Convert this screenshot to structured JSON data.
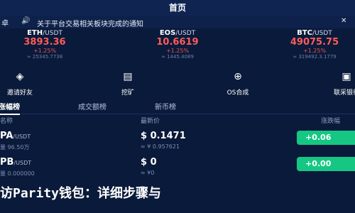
{
  "header": {
    "title": "首页"
  },
  "notice": {
    "mark": "卓",
    "text": "关于平台交易相关板块完成的通知"
  },
  "tickers": [
    {
      "pair_base": "ETH",
      "pair_quote": "/USDT",
      "price": "3893.36",
      "change": "+1.25%",
      "volume": "≈ 25345.7738"
    },
    {
      "pair_base": "EOS",
      "pair_quote": "/USDT",
      "price": "10.6619",
      "change": "+1.25%",
      "volume": "≈ 1445.4089"
    },
    {
      "pair_base": "BTC",
      "pair_quote": "/USDT",
      "price": "49075.75",
      "change": "+1.25%",
      "volume": "≈ 319492.3.1779"
    }
  ],
  "quick": [
    {
      "icon": "gift-icon",
      "label": "邀请好友"
    },
    {
      "icon": "pickaxe-icon",
      "label": "挖矿"
    },
    {
      "icon": "os-icon",
      "label": "OS合成"
    },
    {
      "icon": "bank-icon",
      "label": "联采银行"
    }
  ],
  "tabs": [
    "涨幅榜",
    "成交额榜",
    "新币榜"
  ],
  "columns": {
    "name": "名称",
    "price": "最新价",
    "change": "涨跌幅"
  },
  "rows": [
    {
      "symbol": "PA",
      "quote": "/USDT",
      "volume": "量 96.50万",
      "price": "$ 0.1471",
      "cny": "≈ ¥ 0.957621",
      "change": "+0.06"
    },
    {
      "symbol": "PB",
      "quote": "/USDT",
      "volume": "量 0.000000",
      "price": "$ 0",
      "cny": "≈ ¥0",
      "change": "+0.00"
    }
  ],
  "banner": {
    "text": "访Parity钱包：详细步骤与"
  },
  "colors": {
    "background": "#0a1a3a",
    "topbar": "#102452",
    "price_down": "#ff5b5b",
    "badge_up": "#16c784"
  }
}
